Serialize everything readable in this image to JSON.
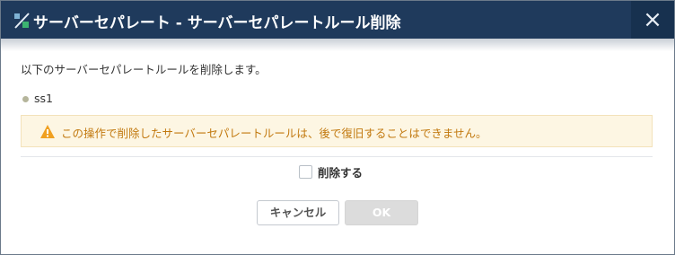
{
  "dialog": {
    "title": "サーバーセパレート - サーバーセパレートルール削除",
    "close_symbol": "×",
    "intro_text": "以下のサーバーセパレートルールを削除します。",
    "items": [
      "ss1"
    ],
    "warning_text": "この操作で削除したサーバーセパレートルールは、後で復旧することはできません。",
    "checkbox_label": "削除する",
    "checkbox_checked": false,
    "cancel_label": "キャンセル",
    "ok_label": "OK",
    "ok_enabled": false
  },
  "icons": {
    "title": "server-separate-icon",
    "close": "close-icon",
    "warning": "warning-icon",
    "bullet": "bullet-dot-icon"
  },
  "colors": {
    "titlebar": "#1f3a5c",
    "warning_text": "#c2790f",
    "warning_bg": "#fdf6e3",
    "warning_icon": "#f0a020"
  }
}
